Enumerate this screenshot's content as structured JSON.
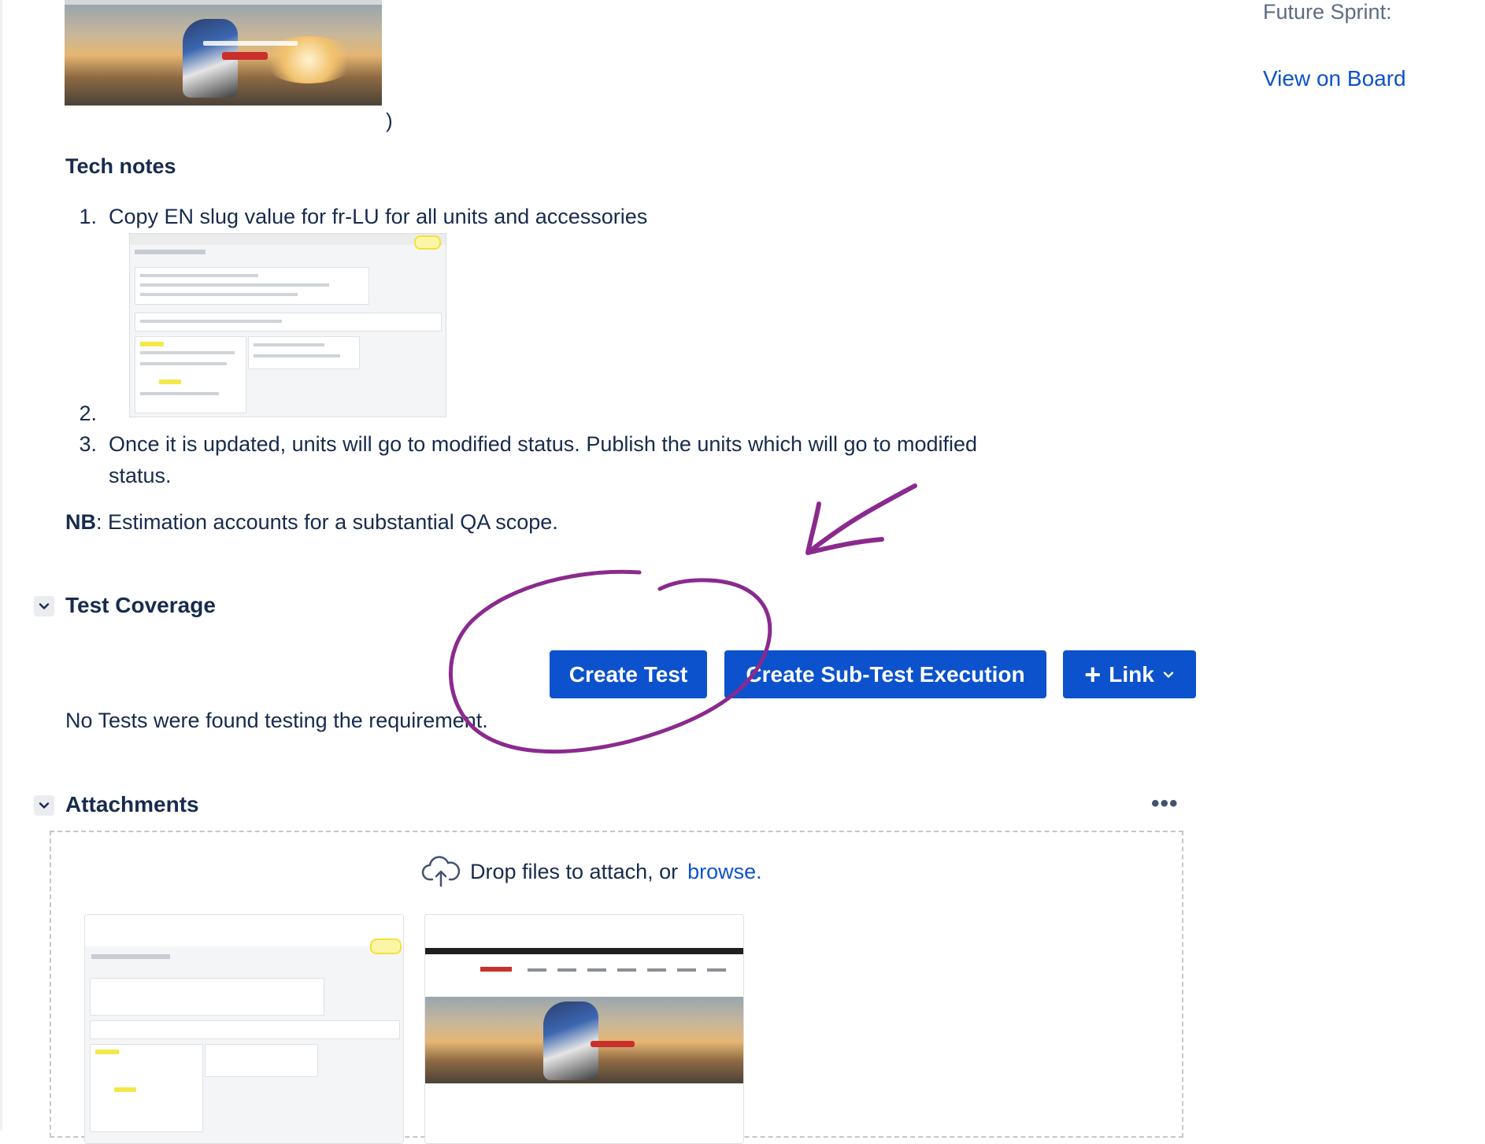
{
  "sidebar": {
    "future_sprint_label": "Future Sprint:",
    "view_on_board": "View on Board"
  },
  "description": {
    "closing_paren": ")",
    "tech_notes_heading": "Tech notes",
    "list": [
      {
        "num": "1.",
        "text": "Copy EN slug value for fr-LU for all units and accessories"
      },
      {
        "num": "2.",
        "text": ""
      },
      {
        "num": "3.",
        "text_line1": "Once it is updated, units will go to modified status. Publish the units which will go to modified",
        "text_line2": "status."
      }
    ],
    "nb_label": "NB",
    "nb_text": ": Estimation accounts for a substantial QA scope."
  },
  "test_coverage": {
    "title": "Test Coverage",
    "create_test": "Create Test",
    "create_sub_test_execution": "Create Sub-Test Execution",
    "link_label": "Link",
    "link_plus": "+",
    "empty_message": "No Tests were found testing the requirement."
  },
  "attachments": {
    "title": "Attachments",
    "more": "•••",
    "drop_text": "Drop files to attach, or",
    "browse": "browse."
  },
  "icons": {
    "chevron": "chevron-down-icon",
    "upload": "cloud-upload-icon",
    "more": "more-icon"
  },
  "colors": {
    "primary_button": "#0c52cc",
    "link": "#0c52cc",
    "annotation": "#8a2a8e",
    "text": "#172b4d"
  }
}
